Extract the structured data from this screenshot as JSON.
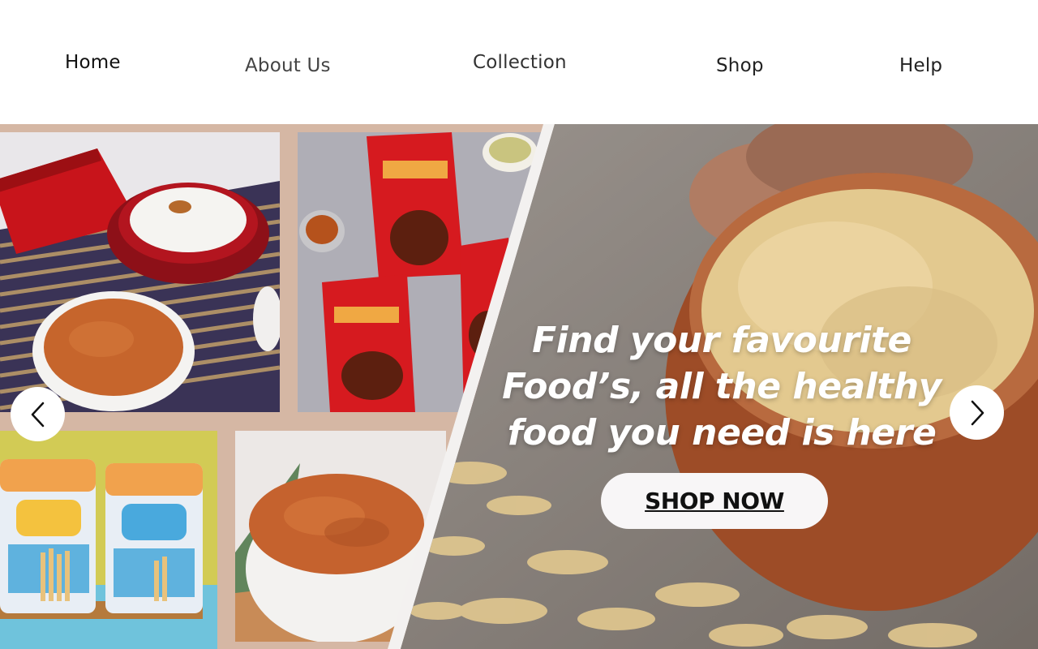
{
  "nav": {
    "items": [
      {
        "label": "Home"
      },
      {
        "label": "About Us"
      },
      {
        "label": "Collection"
      },
      {
        "label": "Shop"
      },
      {
        "label": "Help"
      }
    ]
  },
  "hero": {
    "headline_line1": "Find your favourite",
    "headline_line2": "Food’s, all the healthy",
    "headline_line3": "food you need is here",
    "cta_label": "SHOP NOW",
    "prev_icon": "chevron-left-icon",
    "next_icon": "chevron-right-icon"
  },
  "colors": {
    "collage_background": "#d5b7a4",
    "headline": "#ffffff",
    "cta_background": "#f8f6f7",
    "cta_text": "#111111"
  }
}
